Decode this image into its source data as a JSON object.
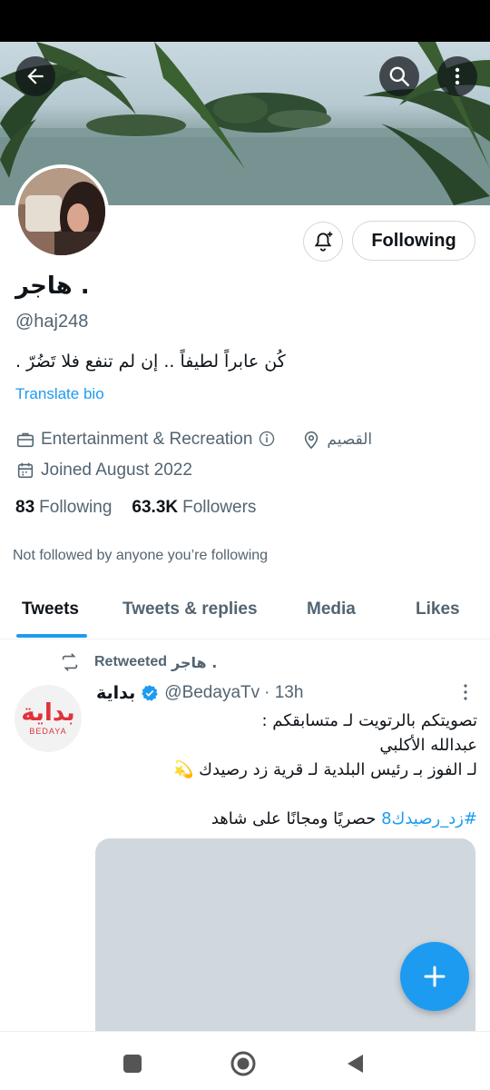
{
  "profile": {
    "display_name": "هاجر .",
    "handle": "@haj248",
    "bio": "كُن عابراً لطيفاً .. إن لم تنفع فلا تَضُرّ .",
    "translate_label": "Translate bio",
    "category": "Entertainment & Recreation",
    "location": "القصيم",
    "joined": "Joined August 2022",
    "following_count": "83",
    "following_label": "Following",
    "followers_count": "63.3K",
    "followers_label": "Followers",
    "not_followed_text": "Not followed by anyone you’re following",
    "follow_button_label": "Following"
  },
  "tabs": [
    "Tweets",
    "Tweets & replies",
    "Media",
    "Likes"
  ],
  "active_tab": "Tweets",
  "tweet": {
    "retweet_label": "Retweeted",
    "retweeter": "هاجر .",
    "author_name": "بداية",
    "author_handle": "@BedayaTv",
    "time": "· 13h",
    "avatar_logo_ar": "بداية",
    "avatar_logo_en": "BEDAYA",
    "lines": [
      "تصويتكم بالرتويت لـ متسابقكم :",
      "عبدالله الأكلبي",
      "لـ الفوز بـ رئيس البلدية لـ قرية زد رصيدك 💫"
    ],
    "hashtag": "#زد_رصيدك8",
    "trailing_text": " حصريًا ومجانًا على شاهد"
  },
  "icons": {
    "back": "arrow-left-icon",
    "search": "search-icon",
    "more": "more-vertical-icon",
    "bell": "bell-plus-icon",
    "category": "briefcase-icon",
    "info": "info-icon",
    "location": "location-pin-icon",
    "calendar": "calendar-icon",
    "retweet": "retweet-icon",
    "verified": "verified-badge-icon",
    "compose": "plus-icon"
  },
  "colors": {
    "accent": "#1d9bf0",
    "text": "#0f1419",
    "secondary": "#536471",
    "brand_red": "#e0323b"
  }
}
